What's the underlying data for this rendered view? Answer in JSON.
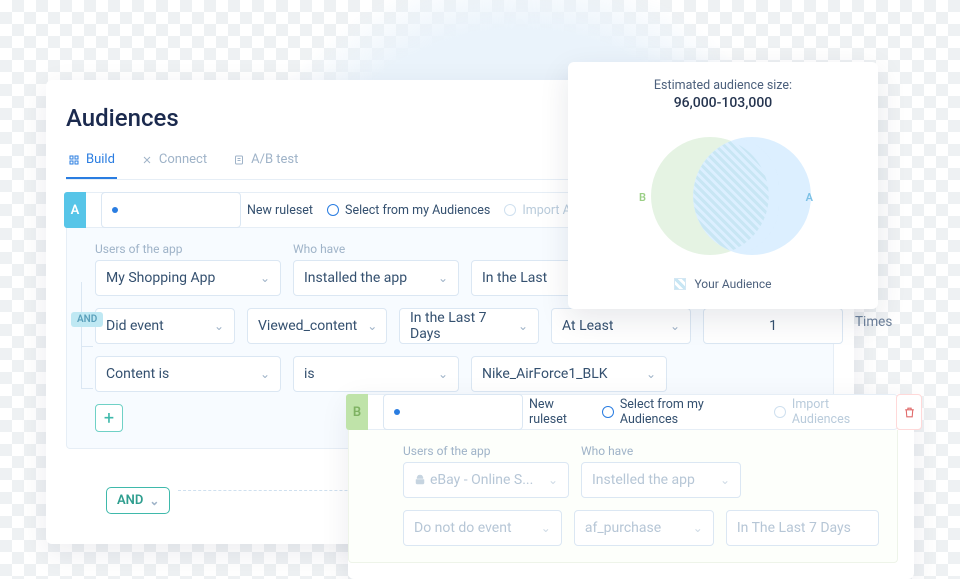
{
  "page_title": "Audiences",
  "tabs": {
    "build": "Build",
    "connect": "Connect",
    "abtest": "A/B test"
  },
  "opts": {
    "new_ruleset": "New ruleset",
    "select_from": "Select from my Audiences",
    "import": "Import Audiences"
  },
  "labels": {
    "users_of_app": "Users of the app",
    "who_have": "Who have",
    "times": "Times"
  },
  "ruleset_a": {
    "badge": "A",
    "app": "My Shopping App",
    "who_have": "Installed the app",
    "who_have_window": "In the Last",
    "row2_event_type": "Did event",
    "row2_event_name": "Viewed_content",
    "row2_window": "In the Last 7 Days",
    "row2_comparator": "At Least",
    "row2_count": "1",
    "row3_field": "Content is",
    "row3_op": "is",
    "row3_value": "Nike_AirForce1_BLK"
  },
  "and_pill": "AND",
  "and_big": "AND",
  "ruleset_b": {
    "badge": "B",
    "app": "eBay - Online S...",
    "who_have": "Instelled the app",
    "row2_event_type": "Do not do event",
    "row2_event_name": "af_purchase",
    "row2_window": "In The Last 7 Days"
  },
  "estimator": {
    "title": "Estimated audience size:",
    "value": "96,000-103,000",
    "labelA": "A",
    "labelB": "B",
    "legend": "Your Audience"
  }
}
